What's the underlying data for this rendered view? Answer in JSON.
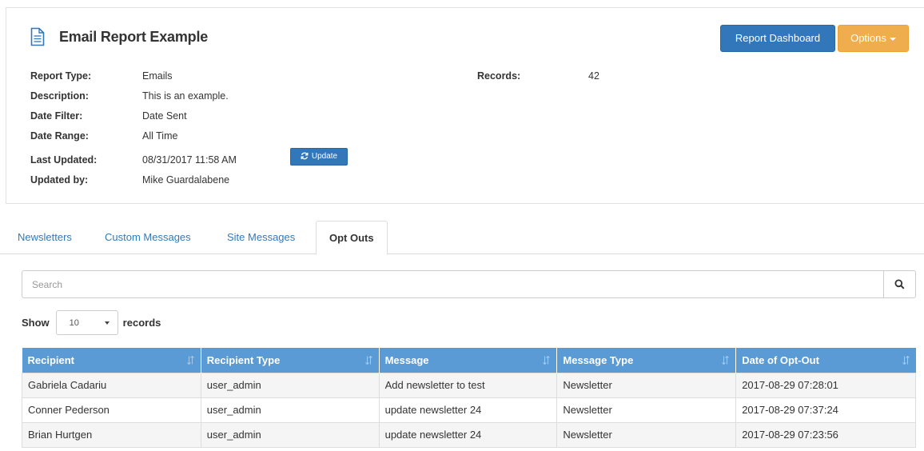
{
  "report": {
    "title": "Email Report Example",
    "dashboard_label": "Report Dashboard",
    "options_label": "Options",
    "update_label": "Update",
    "fields": [
      {
        "label": "Report Type:",
        "value": "Emails"
      },
      {
        "label": "Description:",
        "value": "This is an example."
      },
      {
        "label": "Date Filter:",
        "value": "Date Sent"
      },
      {
        "label": "Date Range:",
        "value": "All Time"
      },
      {
        "label": "Last Updated:",
        "value": "08/31/2017 11:58 AM"
      },
      {
        "label": "Updated by:",
        "value": "Mike Guardalabene"
      }
    ],
    "records_label": "Records:",
    "records_value": "42"
  },
  "tabs": [
    {
      "label": "Newsletters"
    },
    {
      "label": "Custom Messages"
    },
    {
      "label": "Site Messages"
    },
    {
      "label": "Opt Outs",
      "active": true
    }
  ],
  "search": {
    "placeholder": "Search"
  },
  "show": {
    "prefix": "Show",
    "value": "10",
    "suffix": "records"
  },
  "table": {
    "headers": [
      "Recipient",
      "Recipient Type",
      "Message",
      "Message Type",
      "Date of Opt-Out"
    ],
    "rows": [
      [
        "Gabriela Cadariu",
        "user_admin",
        "Add newsletter to test",
        "Newsletter",
        "2017-08-29 07:28:01"
      ],
      [
        "Conner Pederson",
        "user_admin",
        "update newsletter 24",
        "Newsletter",
        "2017-08-29 07:37:24"
      ],
      [
        "Brian Hurtgen",
        "user_admin",
        "update newsletter 24",
        "Newsletter",
        "2017-08-29 07:23:56"
      ]
    ]
  },
  "colors": {
    "primary": "#3277b9",
    "warning": "#f0ad4e",
    "table_header": "#5b9bd5",
    "link": "#337ab7"
  },
  "icons": {
    "title": "document-icon",
    "update": "refresh-icon",
    "search": "search-icon",
    "sort": "sort-icon"
  }
}
